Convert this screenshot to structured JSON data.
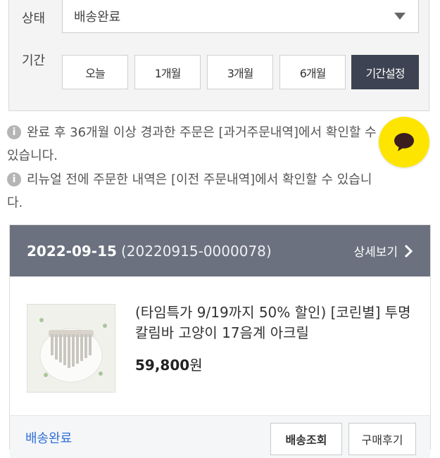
{
  "filter": {
    "status_label": "상태",
    "status_value": "배송완료",
    "period_label": "기간",
    "periods": [
      "오늘",
      "1개월",
      "3개월",
      "6개월",
      "기간설정"
    ],
    "active_period": "기간설정"
  },
  "notices": [
    {
      "line1": "완료 후 36개월 이상 경과한 주문은 [과거주문내역]에서 확인할 수",
      "line2": "있습니다."
    },
    {
      "line1": "리뉴얼 전에 주문한 내역은 [이전 주문내역]에서 확인할 수 있습니",
      "line2": "다."
    }
  ],
  "order": {
    "date": "2022-09-15",
    "number": "(20220915-0000078)",
    "detail_label": "상세보기",
    "product_name": "(타임특가 9/19까지 50% 할인) [코린별] 투명 칼림바 고양이 17음계 아크릴",
    "price": "59,800",
    "price_unit": "원",
    "status": "배송완료",
    "actions": [
      "배송조회",
      "구매후기"
    ]
  },
  "colors": {
    "header_bg": "#6b717f",
    "active_btn": "#3d4352",
    "chat_yellow": "#fde500",
    "status_blue": "#2f6fd6"
  }
}
